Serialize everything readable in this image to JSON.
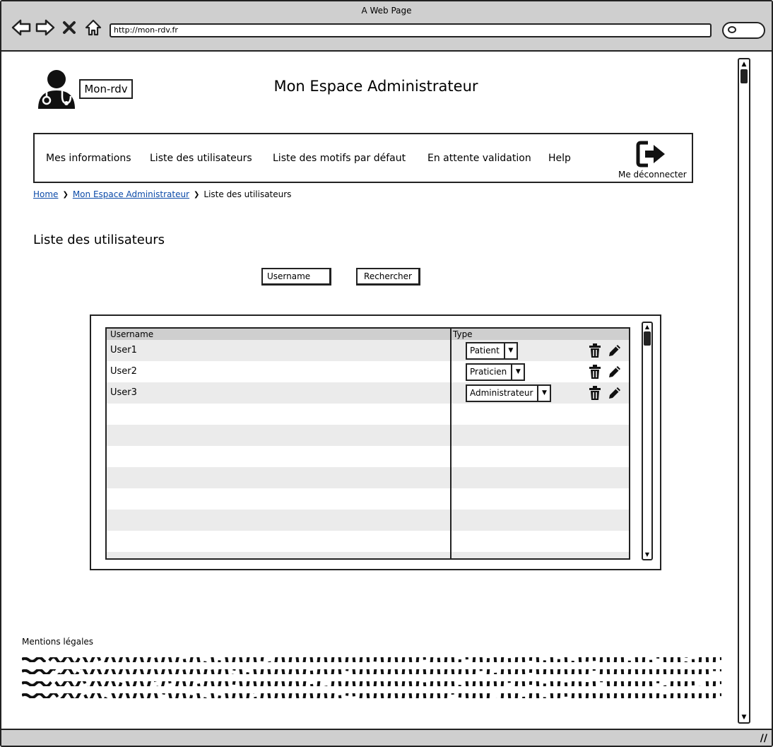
{
  "browser": {
    "window_title": "A Web Page",
    "url": "http://mon-rdv.fr",
    "nav_icons": [
      "back-arrow-icon",
      "forward-arrow-icon",
      "close-x-icon",
      "home-icon"
    ]
  },
  "header": {
    "logo_text": "Mon-rdv",
    "page_title": "Mon Espace Administrateur"
  },
  "nav": {
    "items": [
      {
        "label": "Mes informations"
      },
      {
        "label": "Liste des utilisateurs"
      },
      {
        "label": "Liste des motifs par défaut"
      },
      {
        "label": "En attente validation"
      },
      {
        "label": "Help"
      }
    ],
    "logout_label": "Me déconnecter"
  },
  "breadcrumb": {
    "home": "Home",
    "parent": "Mon Espace Administrateur",
    "current": "Liste des utilisateurs"
  },
  "section_title": "Liste des utilisateurs",
  "search": {
    "input_value": "Username",
    "button_label": "Rechercher"
  },
  "table": {
    "headers": [
      "Username",
      "Type"
    ],
    "rows": [
      {
        "username": "User1",
        "type": "Patient"
      },
      {
        "username": "User2",
        "type": "Praticien"
      },
      {
        "username": "User3",
        "type": "Administrateur"
      }
    ]
  },
  "footer": {
    "title": "Mentions légales"
  }
}
